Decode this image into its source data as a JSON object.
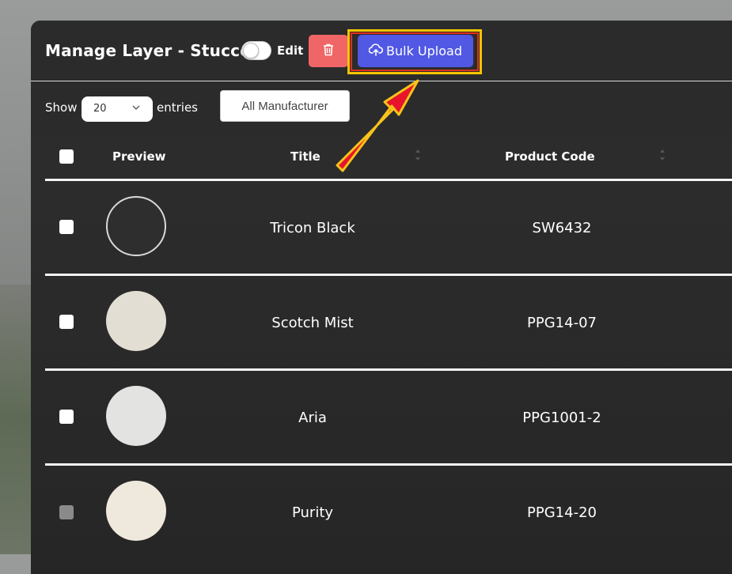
{
  "header": {
    "title": "Manage Layer - Stucco",
    "edit_label": "Edit",
    "edit_toggle_on": false,
    "bulk_upload_label": "Bulk Upload"
  },
  "controls": {
    "show_label": "Show",
    "entries_value": "20",
    "entries_label": "entries",
    "manufacturer_filter": "All Manufacturer"
  },
  "table": {
    "columns": [
      "Preview",
      "Title",
      "Product Code"
    ],
    "rows": [
      {
        "title": "Tricon Black",
        "code": "SW6432",
        "color": "#2e2e2e"
      },
      {
        "title": "Scotch Mist",
        "code": "PPG14-07",
        "color": "#e3ded3"
      },
      {
        "title": "Aria",
        "code": "PPG1001-2",
        "color": "#e3e3e1"
      },
      {
        "title": "Purity",
        "code": "PPG14-20",
        "color": "#efe9dd"
      }
    ]
  },
  "colors": {
    "delete": "#f06666",
    "primary": "#5158e3",
    "highlight_outer": "#f6c400",
    "highlight_inner": "#e22f1c",
    "arrow_fill": "#e8142c",
    "arrow_stroke": "#f8c41a"
  },
  "icons": {
    "delete": "trash-icon",
    "upload": "cloud-upload-icon",
    "chevron": "chevron-down-icon",
    "sort": "sort-icon"
  }
}
